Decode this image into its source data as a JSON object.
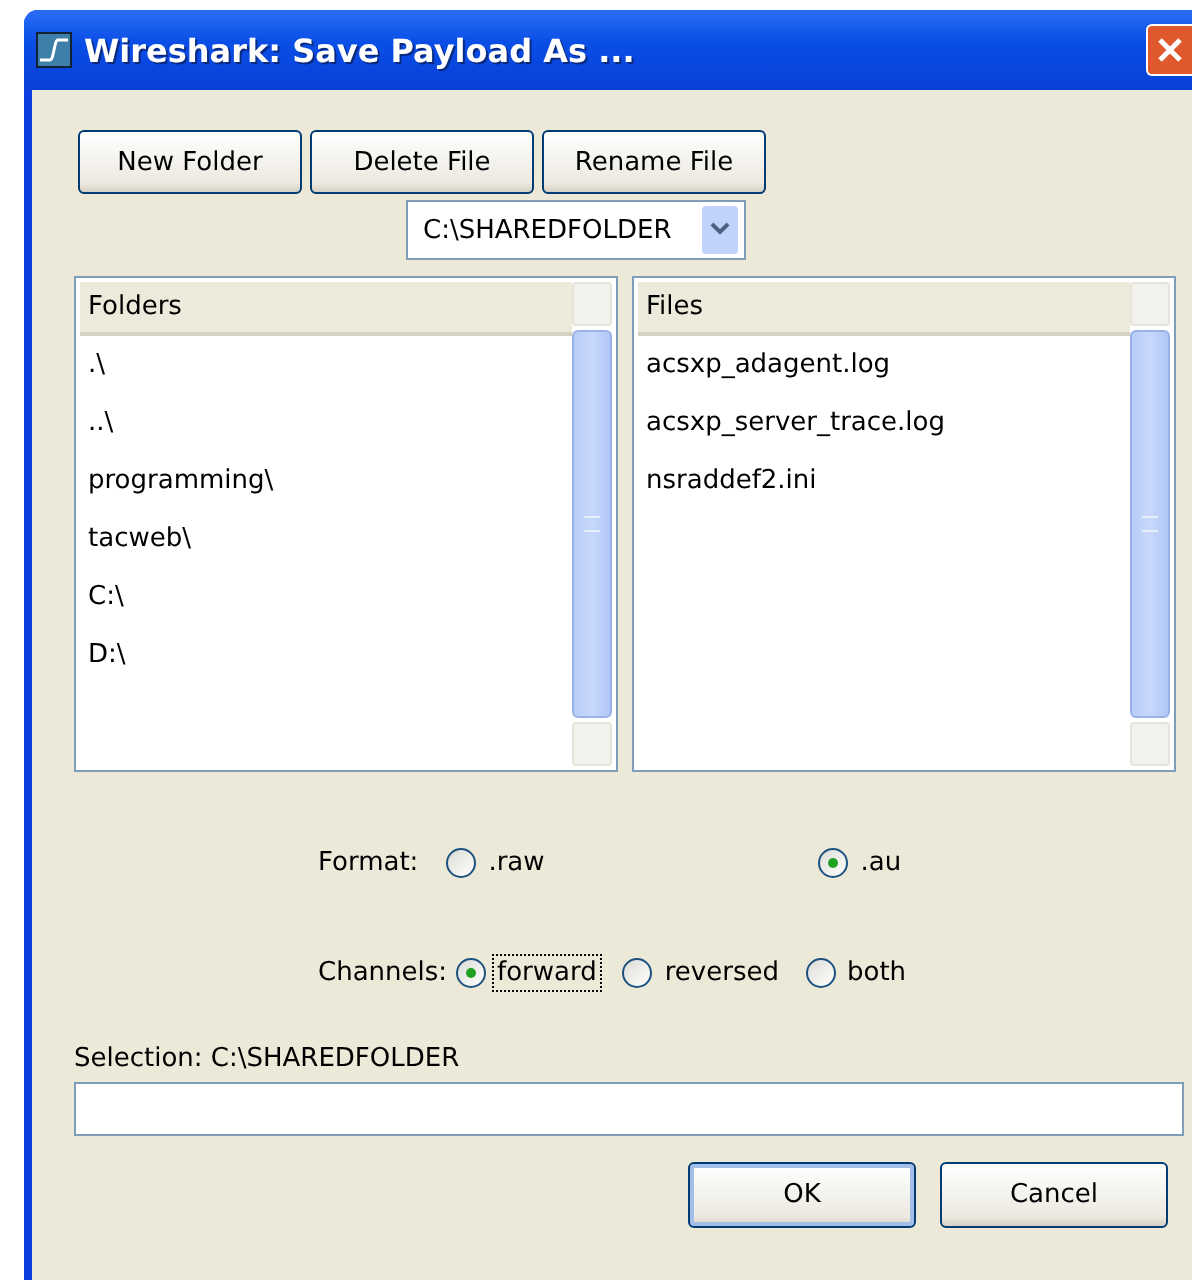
{
  "window": {
    "title": "Wireshark: Save Payload As ..."
  },
  "toolbar": {
    "buttons": [
      "New Folder",
      "Delete File",
      "Rename File"
    ]
  },
  "path_combo": {
    "value": "C:\\SHAREDFOLDER"
  },
  "folders": {
    "heading": "Folders",
    "items": [
      ".\\",
      "..\\",
      "programming\\",
      "tacweb\\",
      "C:\\",
      "D:\\"
    ]
  },
  "files": {
    "heading": "Files",
    "items": [
      "acsxp_adagent.log",
      "acsxp_server_trace.log",
      "nsraddef2.ini"
    ]
  },
  "format": {
    "label": "Format:",
    "options": [
      {
        "label": ".raw",
        "selected": false,
        "focused": false
      },
      {
        "label": ".au",
        "selected": true,
        "focused": false
      }
    ]
  },
  "channels": {
    "label": "Channels:",
    "options": [
      {
        "label": "forward",
        "selected": true,
        "focused": true
      },
      {
        "label": "reversed",
        "selected": false,
        "focused": false
      },
      {
        "label": "both",
        "selected": false,
        "focused": false
      }
    ]
  },
  "selection": {
    "label": "Selection: C:\\SHAREDFOLDER"
  },
  "buttons": [
    {
      "label": "OK",
      "default": true
    },
    {
      "label": "Cancel",
      "default": false
    }
  ]
}
